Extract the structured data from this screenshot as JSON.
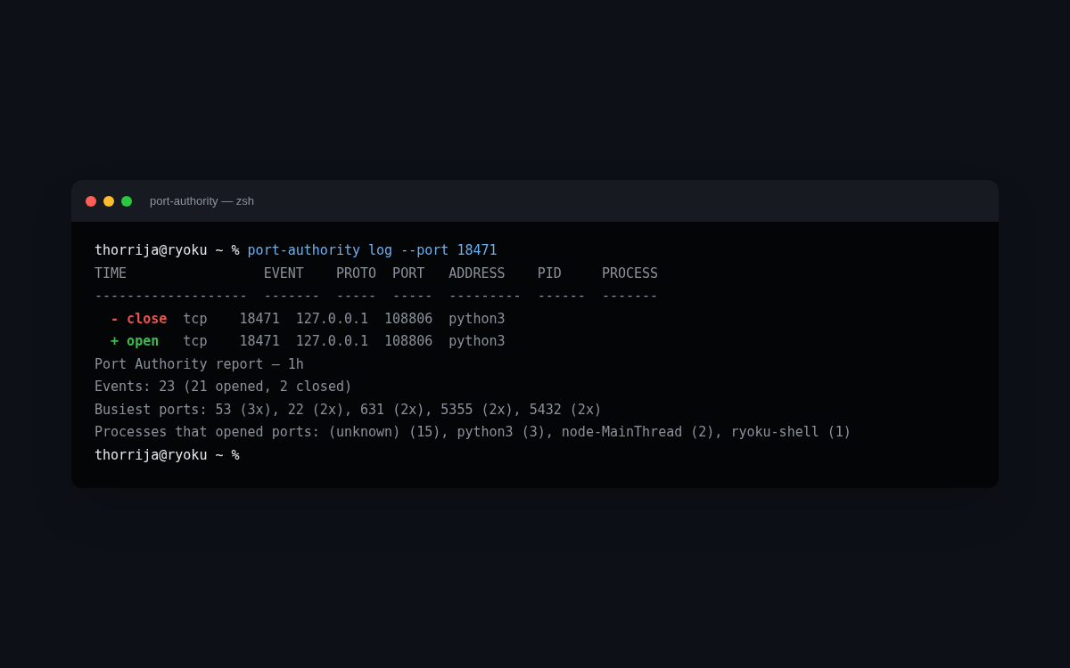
{
  "window": {
    "title": "port-authority — zsh"
  },
  "prompt": {
    "user": "thorrija@ryoku ~ %",
    "command": "port-authority log --port 18471"
  },
  "table": {
    "columns": [
      "TIME",
      "EVENT",
      "PROTO",
      "PORT",
      "ADDRESS",
      "PID",
      "PROCESS"
    ],
    "dividers": [
      "-------------------",
      "-------",
      "-----",
      "-----",
      "---------",
      "------",
      "-------"
    ],
    "rows": [
      {
        "kind": "close",
        "event": "- close",
        "proto": "tcp",
        "port": "18471",
        "address": "127.0.0.1",
        "pid": "108806",
        "process": "python3"
      },
      {
        "kind": "open",
        "event": "+ open",
        "proto": "tcp",
        "port": "18471",
        "address": "127.0.0.1",
        "pid": "108806",
        "process": "python3"
      }
    ]
  },
  "report": [
    "Port Authority report — 1h",
    "Events: 23 (21 opened, 2 closed)",
    "Busiest ports: 53 (3x), 22 (2x), 631 (2x), 5355 (2x), 5432 (2x)",
    "Processes that opened ports: (unknown) (15), python3 (3), node-MainThread (2), ryoku-shell (1)"
  ],
  "final_prompt": "thorrija@ryoku ~ %"
}
